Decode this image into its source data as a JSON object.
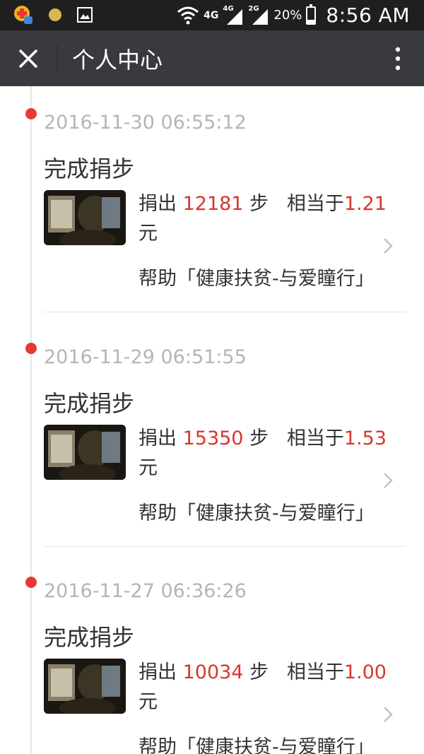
{
  "status_bar": {
    "network_4g": "4G",
    "signal_4g": "4G",
    "signal_2g": "2G",
    "battery_percent": "20%",
    "battery_level": 0.2,
    "time": "8:56 AM"
  },
  "title_bar": {
    "title": "个人中心",
    "close_icon": "close-icon",
    "more_icon": "more-vertical-icon"
  },
  "accent_color": "#d9362b",
  "entries": [
    {
      "time": "2016-11-30 06:55:12",
      "title": "完成捐步",
      "donate_prefix": "捐出 ",
      "steps": "12181",
      "steps_unit": " 步",
      "equiv_prefix": "相当于",
      "amount": "1.21",
      "currency": "元",
      "help_text": "帮助「健康扶贫-与爱瞳行」"
    },
    {
      "time": "2016-11-29 06:51:55",
      "title": "完成捐步",
      "donate_prefix": "捐出 ",
      "steps": "15350",
      "steps_unit": " 步",
      "equiv_prefix": "相当于",
      "amount": "1.53",
      "currency": "元",
      "help_text": "帮助「健康扶贫-与爱瞳行」"
    },
    {
      "time": "2016-11-27 06:36:26",
      "title": "完成捐步",
      "donate_prefix": "捐出 ",
      "steps": "10034",
      "steps_unit": " 步",
      "equiv_prefix": "相当于",
      "amount": "1.00",
      "currency": "元",
      "help_text": "帮助「健康扶贫-与爱瞳行」"
    }
  ]
}
